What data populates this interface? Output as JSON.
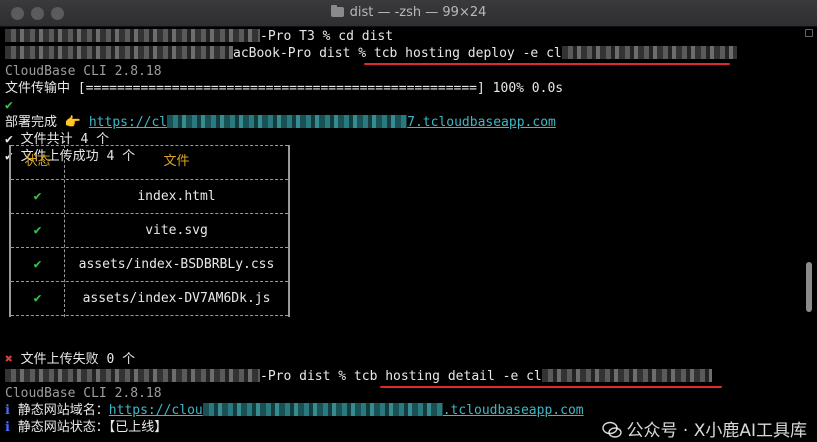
{
  "window": {
    "title": "dist — -zsh — 99×24"
  },
  "terminal": {
    "line1_suffix": "-Pro T3 % cd dist",
    "line2_suffix": "acBook-Pro dist % tcb hosting deploy -e cl",
    "cli_version": "CloudBase CLI 2.8.18",
    "progress_label": "文件传输中",
    "progress_bar": "[==================================================]",
    "progress_value": "100% 0.0s",
    "check": "✔",
    "deploy_done_label": "部署完成",
    "pointing_hand": "👉",
    "deploy_url_prefix": "https://cl",
    "deploy_url_suffix": "7.tcloudbaseapp.com",
    "files_total": "✔ 文件共计 4 个",
    "files_ok": "✔ 文件上传成功 4 个",
    "table": {
      "col_status": "状态",
      "col_file": "文件",
      "rows": [
        {
          "status": "✔",
          "file": "index.html"
        },
        {
          "status": "✔",
          "file": "vite.svg"
        },
        {
          "status": "✔",
          "file": "assets/index-BSDBRBLy.css"
        },
        {
          "status": "✔",
          "file": "assets/index-DV7AM6Dk.js"
        }
      ]
    },
    "fail_mark": "✖",
    "files_failed": "文件上传失败 0 个",
    "line_detail_middle": "-Pro dist % tcb hosting detail -e cl",
    "cli_version2": "CloudBase CLI 2.8.18",
    "info_mark": "ℹ",
    "site_domain_label": "静态网站域名：",
    "site_domain_prefix": "https://clou",
    "site_domain_suffix": ".tcloudbaseapp.com",
    "site_status_label": "静态网站状态：",
    "site_status_value": "【已上线】"
  },
  "watermark": {
    "text": "公众号 · X小鹿AI工具库"
  },
  "colors": {
    "accent_link": "#3fb8c6",
    "success": "#39c34e",
    "error": "#e03b3b",
    "annotation": "#e02a2a",
    "header": "#d9a520"
  }
}
